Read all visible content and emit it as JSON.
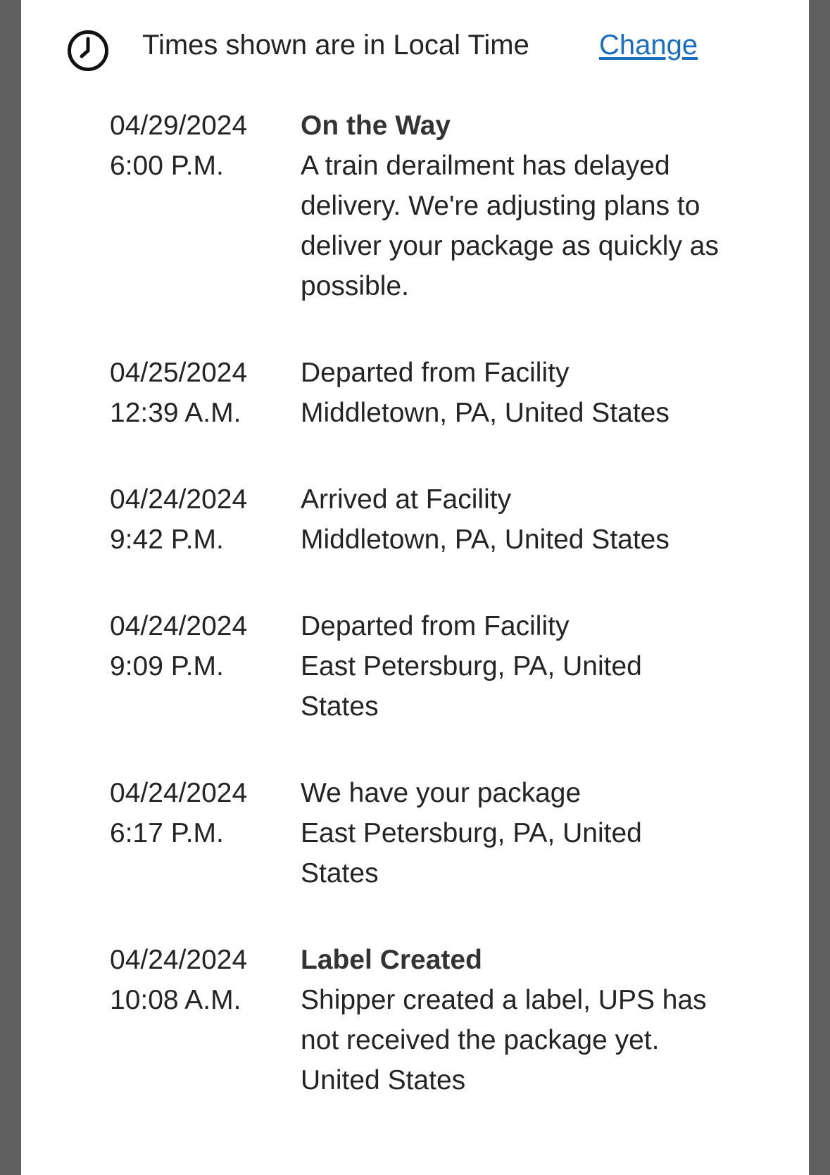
{
  "colors": {
    "frame": "#5f5f5f",
    "panel": "#ffffff",
    "text": "#242424",
    "link": "#1a6ec0"
  },
  "timezone": {
    "icon": "clock-icon",
    "text": "Times shown are in Local Time",
    "change_label": "Change"
  },
  "events": [
    {
      "date": "04/29/2024",
      "time": "6:00 P.M.",
      "status": "On the Way",
      "status_bold": true,
      "detail": "A train derailment has delayed delivery. We're adjusting plans to deliver your package as quickly as possible."
    },
    {
      "date": "04/25/2024",
      "time": "12:39 A.M.",
      "status": "Departed from Facility",
      "status_bold": false,
      "location": "Middletown, PA, United States"
    },
    {
      "date": "04/24/2024",
      "time": "9:42 P.M.",
      "status": "Arrived at Facility",
      "status_bold": false,
      "location": "Middletown, PA, United States"
    },
    {
      "date": "04/24/2024",
      "time": "9:09 P.M.",
      "status": "Departed from Facility",
      "status_bold": false,
      "location": "East Petersburg, PA, United States"
    },
    {
      "date": "04/24/2024",
      "time": "6:17 P.M.",
      "status": "We have your package",
      "status_bold": false,
      "location": "East Petersburg, PA, United States"
    },
    {
      "date": "04/24/2024",
      "time": "10:08 A.M.",
      "status": "Label Created",
      "status_bold": true,
      "detail": "Shipper created a label, UPS has not received the package yet.",
      "location": "United States"
    }
  ]
}
